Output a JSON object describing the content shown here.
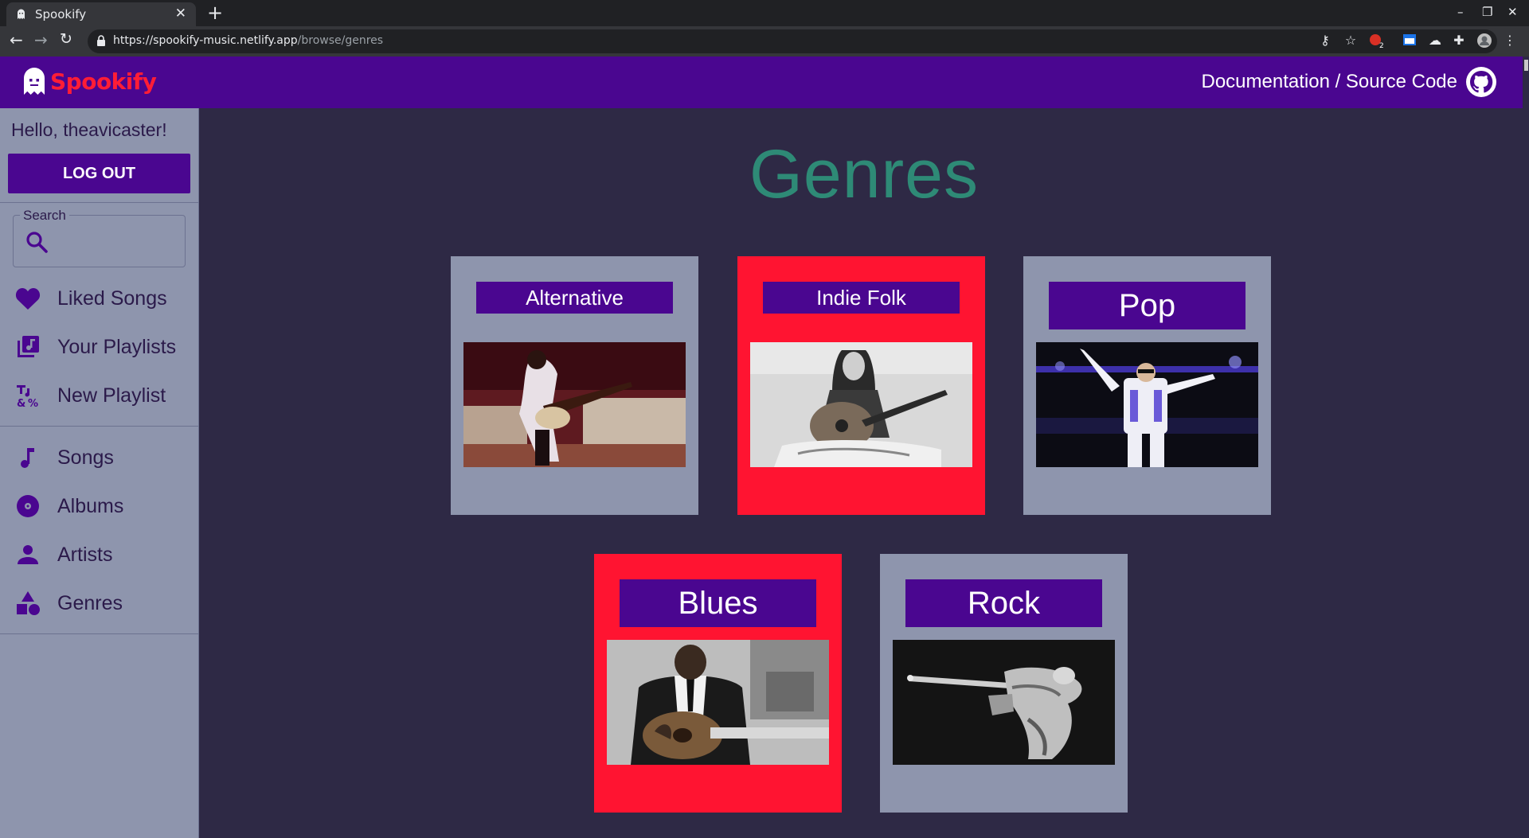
{
  "browser": {
    "tab_title": "Spookify",
    "tab_close": "✕",
    "new_tab": "+",
    "url_host": "https://spookify-music.netlify.app",
    "url_path": "/browse/genres",
    "ext_badge": "2"
  },
  "header": {
    "brand": "Spookify",
    "doc_link": "Documentation / Source Code"
  },
  "sidebar": {
    "greeting": "Hello, theavicaster!",
    "logout_label": "LOG OUT",
    "search_label": "Search",
    "search_value": "",
    "items": [
      {
        "label": "Liked Songs",
        "icon": "heart-icon"
      },
      {
        "label": "Your Playlists",
        "icon": "playlist-icon"
      },
      {
        "label": "New Playlist",
        "icon": "new-playlist-icon"
      },
      {
        "label": "Songs",
        "icon": "music-note-icon"
      },
      {
        "label": "Albums",
        "icon": "album-icon"
      },
      {
        "label": "Artists",
        "icon": "person-icon"
      },
      {
        "label": "Genres",
        "icon": "shapes-icon"
      }
    ]
  },
  "main": {
    "title": "Genres",
    "genres": [
      {
        "name": "Alternative",
        "style": "gray"
      },
      {
        "name": "Indie Folk",
        "style": "red"
      },
      {
        "name": "Pop",
        "style": "gray"
      },
      {
        "name": "Blues",
        "style": "red"
      },
      {
        "name": "Rock",
        "style": "gray"
      }
    ]
  },
  "colors": {
    "header_bg": "#4a0690",
    "brand_red": "#ff1d36",
    "page_bg": "#2e2945",
    "sidebar_bg": "#8e95ad",
    "title_teal": "#2e8a76",
    "card_red": "#ff1431"
  }
}
